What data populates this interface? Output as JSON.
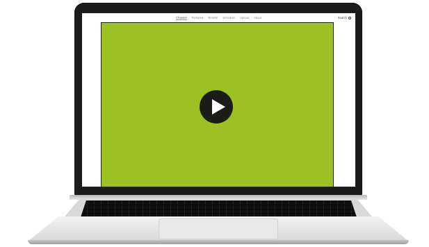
{
  "site": {
    "nav_links": [
      {
        "label": "Channel",
        "active": true
      },
      {
        "label": "Featured",
        "active": false
      },
      {
        "label": "Browse",
        "active": false
      },
      {
        "label": "Schedule",
        "active": false
      },
      {
        "label": "Upload",
        "active": false
      },
      {
        "label": "About",
        "active": false
      }
    ],
    "search_label": "Search"
  },
  "player": {
    "background_color": "#9bc122",
    "play_button_color": "#1c1d18",
    "play_icon": "play-icon"
  }
}
